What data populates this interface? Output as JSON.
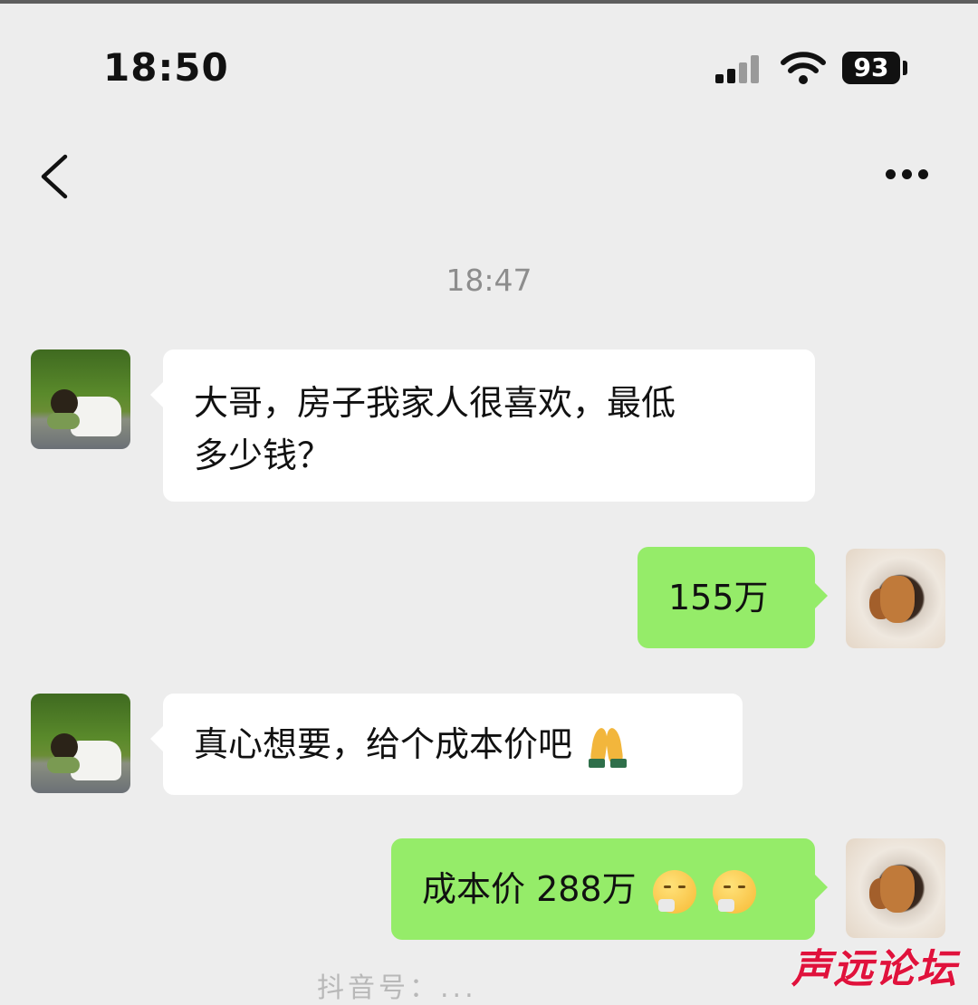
{
  "status_bar": {
    "time": "18:50",
    "battery": "93"
  },
  "chat": {
    "timestamp": "18:47",
    "messages": [
      {
        "side": "in",
        "lines": [
          "大哥，房子我家人很喜欢，最低",
          "多少钱？"
        ]
      },
      {
        "side": "out",
        "text": "155万"
      },
      {
        "side": "in",
        "text": "真心想要，给个成本价吧"
      },
      {
        "side": "out",
        "text": "成本价 288万"
      }
    ]
  },
  "watermark": "声远论坛",
  "bottom_caption": "抖音号：..."
}
